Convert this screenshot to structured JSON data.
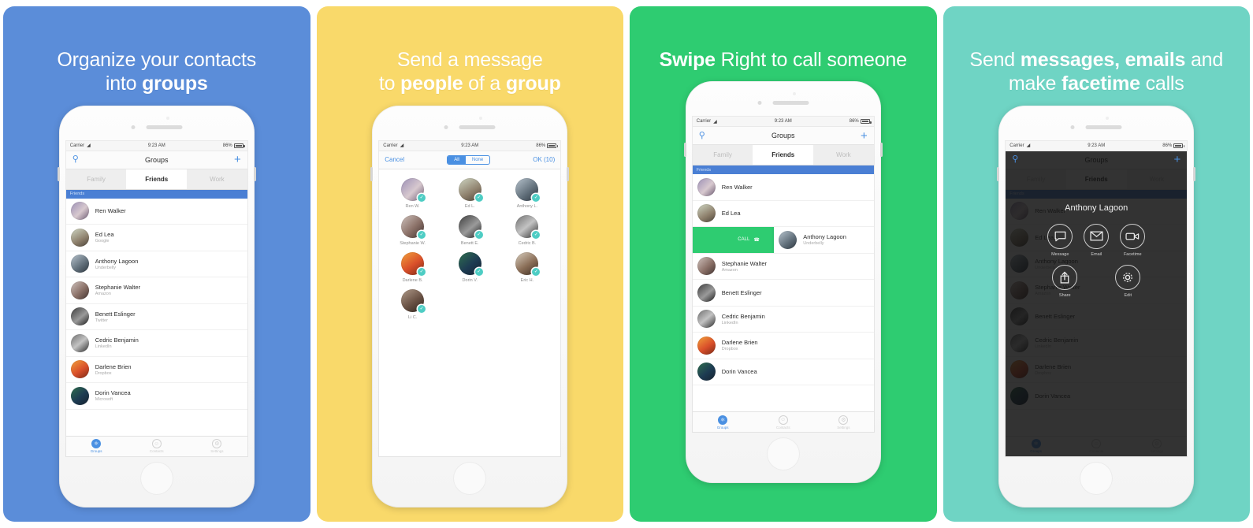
{
  "panels": [
    {
      "id": "organize-groups",
      "bg": "#5b8dd9",
      "headline_pre": "Organize your contacts\ninto ",
      "headline_bold": "groups",
      "headline_post": ""
    },
    {
      "id": "send-message",
      "bg": "#f9d96a",
      "headline_pre": "Send a message\nto ",
      "headline_bold": "people",
      "headline_mid": " of a ",
      "headline_bold2": "group",
      "headline_post": ""
    },
    {
      "id": "swipe-call",
      "bg": "#2ecc71",
      "headline_bold": "Swipe",
      "headline_post": " Right to call someone"
    },
    {
      "id": "message-email-facetime",
      "bg": "#6fd4c4",
      "headline_pre": "Send ",
      "headline_bold": "messages, emails",
      "headline_mid": " and\nmake ",
      "headline_bold2": "facetime",
      "headline_post": " calls"
    }
  ],
  "statusbar": {
    "carrier": "Carrier",
    "wifi_icon": "wifi-icon",
    "time": "9:23 AM",
    "battery_pct": "86%",
    "battery_icon": "battery-icon"
  },
  "navbar": {
    "title": "Groups",
    "search_icon": "search-icon",
    "add_icon": "plus-icon"
  },
  "tabs": [
    {
      "label": "Family",
      "active": false
    },
    {
      "label": "Friends",
      "active": true
    },
    {
      "label": "Work",
      "active": false
    }
  ],
  "section_header": "Friends",
  "contacts": [
    {
      "name": "Ren Walker",
      "sub": "",
      "avatar": "a1"
    },
    {
      "name": "Ed Lea",
      "sub": "Google",
      "avatar": "a2"
    },
    {
      "name": "Anthony Lagoon",
      "sub": "Underbelly",
      "avatar": "a3"
    },
    {
      "name": "Stephanie Walter",
      "sub": "Amazon",
      "avatar": "a4"
    },
    {
      "name": "Benett Eslinger",
      "sub": "Twitter",
      "avatar": "a5"
    },
    {
      "name": "Cedric Benjamin",
      "sub": "LinkedIn",
      "avatar": "a6"
    },
    {
      "name": "Darlene Brien",
      "sub": "Dropbox",
      "avatar": "a7"
    },
    {
      "name": "Dorin Vancea",
      "sub": "Microsoft",
      "avatar": "a8"
    }
  ],
  "tabbar": [
    {
      "label": "Groups",
      "icon": "groups-icon",
      "glyph": "⚇",
      "active": true
    },
    {
      "label": "Contacts",
      "icon": "contacts-icon",
      "glyph": "☺",
      "active": false
    },
    {
      "label": "Settings",
      "icon": "settings-icon",
      "glyph": "⚙",
      "active": false
    }
  ],
  "picker": {
    "cancel_label": "Cancel",
    "ok_label": "OK (10)",
    "segment": [
      {
        "label": "All",
        "selected": true
      },
      {
        "label": "None",
        "selected": false
      }
    ],
    "people": [
      {
        "name": "Ren W.",
        "avatar": "a1",
        "checked": true
      },
      {
        "name": "Ed L.",
        "avatar": "a2",
        "checked": true
      },
      {
        "name": "Anthony L.",
        "avatar": "a3",
        "checked": true
      },
      {
        "name": "Stephanie W.",
        "avatar": "a4",
        "checked": true
      },
      {
        "name": "Benett E.",
        "avatar": "a5",
        "checked": true
      },
      {
        "name": "Cedric B.",
        "avatar": "a6",
        "checked": true
      },
      {
        "name": "Darlene B.",
        "avatar": "a7",
        "checked": true
      },
      {
        "name": "Dorin V.",
        "avatar": "a8",
        "checked": true
      },
      {
        "name": "Eric H.",
        "avatar": "a9",
        "checked": true
      },
      {
        "name": "Li C.",
        "avatar": "a10",
        "checked": true
      }
    ],
    "check_glyph": "✓"
  },
  "swipe": {
    "action_label": "CALL",
    "action_icon": "phone-icon",
    "action_color": "#2ecc71",
    "revealed_contact": {
      "name": "Anthony Lagoon",
      "sub": "Underbelly",
      "avatar": "a3"
    }
  },
  "overlay": {
    "contact_name": "Anthony Lagoon",
    "actions": [
      {
        "label": "Message",
        "icon": "message-bubble-icon"
      },
      {
        "label": "Email",
        "icon": "envelope-icon"
      },
      {
        "label": "Facetime",
        "icon": "video-camera-icon"
      },
      {
        "label": "Share",
        "icon": "share-icon"
      },
      {
        "label": "Edit",
        "icon": "gear-icon"
      }
    ]
  }
}
